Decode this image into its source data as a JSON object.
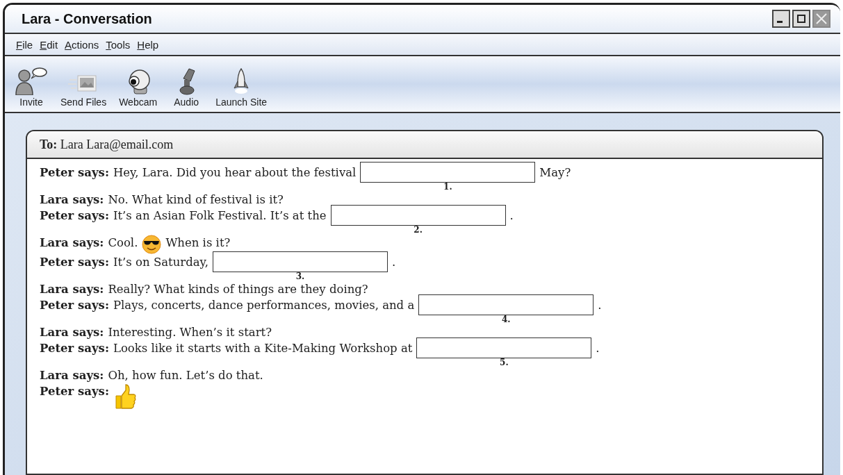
{
  "window": {
    "title": "Lara - Conversation"
  },
  "menu": [
    {
      "label": "File"
    },
    {
      "label": "Edit"
    },
    {
      "label": "Actions"
    },
    {
      "label": "Tools"
    },
    {
      "label": "Help"
    }
  ],
  "toolbar": [
    {
      "kind": "invite",
      "label": "Invite"
    },
    {
      "kind": "files",
      "label": "Send Files"
    },
    {
      "kind": "webcam",
      "label": "Webcam"
    },
    {
      "kind": "audio",
      "label": "Audio"
    },
    {
      "kind": "launch",
      "label": "Launch Site"
    }
  ],
  "to": {
    "label": "To:",
    "value": "Lara Lara@email.com"
  },
  "messages": [
    {
      "speaker": "Peter says:",
      "parts": [
        {
          "kind": "text",
          "text": "Hey, Lara. Did you hear about the festival"
        },
        {
          "kind": "blank",
          "number": "1."
        },
        {
          "kind": "text",
          "text": "May?"
        }
      ]
    },
    {
      "speaker": "Lara says:",
      "parts": [
        {
          "kind": "text",
          "text": "No. What kind of festival is it?"
        }
      ]
    },
    {
      "speaker": "Peter says:",
      "parts": [
        {
          "kind": "text",
          "text": "It’s an Asian Folk Festival. It’s at the"
        },
        {
          "kind": "blank",
          "number": "2."
        },
        {
          "kind": "text",
          "text": "."
        }
      ]
    },
    {
      "speaker": "Lara says:",
      "parts": [
        {
          "kind": "text",
          "text": "Cool."
        },
        {
          "kind": "smiley"
        },
        {
          "kind": "text",
          "text": "When is it?"
        }
      ]
    },
    {
      "speaker": "Peter says:",
      "parts": [
        {
          "kind": "text",
          "text": "It’s on Saturday,"
        },
        {
          "kind": "blank",
          "number": "3."
        },
        {
          "kind": "text",
          "text": "."
        }
      ]
    },
    {
      "speaker": "Lara says:",
      "parts": [
        {
          "kind": "text",
          "text": "Really? What kinds of things are they doing?"
        }
      ]
    },
    {
      "speaker": "Peter says:",
      "parts": [
        {
          "kind": "text",
          "text": "Plays, concerts, dance performances, movies, and a"
        },
        {
          "kind": "blank",
          "number": "4."
        },
        {
          "kind": "text",
          "text": "."
        }
      ]
    },
    {
      "speaker": "Lara says:",
      "parts": [
        {
          "kind": "text",
          "text": "Interesting. When’s it start?"
        }
      ]
    },
    {
      "speaker": "Peter says:",
      "parts": [
        {
          "kind": "text",
          "text": "Looks like it starts with a Kite-Making Workshop at"
        },
        {
          "kind": "blank",
          "number": "5."
        },
        {
          "kind": "text",
          "text": "."
        }
      ]
    },
    {
      "speaker": "Lara says:",
      "parts": [
        {
          "kind": "text",
          "text": "Oh, how fun. Let’s do that."
        }
      ]
    },
    {
      "speaker": "Peter says:",
      "parts": [
        {
          "kind": "thumbs"
        }
      ]
    }
  ]
}
